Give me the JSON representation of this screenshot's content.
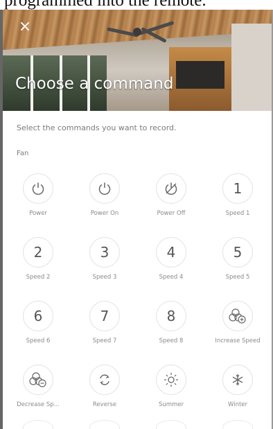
{
  "caption_fragment": "programmed into the remote.",
  "header": {
    "close_icon": "×",
    "title": "Choose a command"
  },
  "instructions": "Select the commands you want to record.",
  "section": "Fan",
  "commands": [
    {
      "label": "Power",
      "icon": "power-icon"
    },
    {
      "label": "Power On",
      "icon": "power-icon"
    },
    {
      "label": "Power Off",
      "icon": "power-off-icon"
    },
    {
      "label": "Speed 1",
      "glyph": "1"
    },
    {
      "label": "Speed 2",
      "glyph": "2"
    },
    {
      "label": "Speed 3",
      "glyph": "3"
    },
    {
      "label": "Speed 4",
      "glyph": "4"
    },
    {
      "label": "Speed 5",
      "glyph": "5"
    },
    {
      "label": "Speed 6",
      "glyph": "6"
    },
    {
      "label": "Speed 7",
      "glyph": "7"
    },
    {
      "label": "Speed 8",
      "glyph": "8"
    },
    {
      "label": "Increase Speed",
      "icon": "fan-increase-icon"
    },
    {
      "label": "Decrease Sp...",
      "icon": "fan-decrease-icon"
    },
    {
      "label": "Reverse",
      "icon": "reverse-icon"
    },
    {
      "label": "Summer",
      "icon": "sun-icon"
    },
    {
      "label": "Winter",
      "icon": "snowflake-icon"
    }
  ]
}
